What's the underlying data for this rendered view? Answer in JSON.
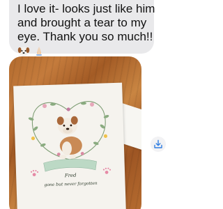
{
  "message": {
    "lines": [
      "I love it- looks just like him",
      "and brought a tear to my",
      "eye. Thank you so much!!"
    ],
    "emojis": [
      "dog-face-emoji",
      "folded-hands-emoji"
    ]
  },
  "photo": {
    "card": {
      "name": "Fred",
      "tagline": "gone but never forgotten"
    }
  },
  "actions": {
    "save_icon": "download-icon"
  },
  "colors": {
    "bubble_gray": "#e9e9eb",
    "accent_blue": "#2f7de1"
  }
}
